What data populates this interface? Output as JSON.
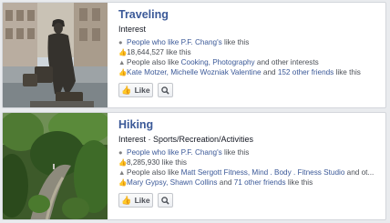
{
  "cards": [
    {
      "title": "Traveling",
      "subtitle": "Interest",
      "lines": [
        {
          "icon": "people-icon",
          "link": "People who like P.F. Chang's",
          "text": " like this"
        },
        {
          "icon": "thumb-up-icon",
          "text": "18,644,527 like this"
        },
        {
          "icon": "network-icon",
          "text": "People also like ",
          "link": "Cooking, Photography",
          "text2": " and other interests"
        },
        {
          "icon": "thumb-up-icon",
          "link": "Kate Motzer, Michelle Wozniak Valentine",
          "text": " and ",
          "link2": "152 other friends",
          "text2": " like this"
        }
      ],
      "like_label": "Like"
    },
    {
      "title": "Hiking",
      "subtitle": "Interest · Sports/Recreation/Activities",
      "lines": [
        {
          "icon": "people-icon",
          "link": "People who like P.F. Chang's",
          "text": " like this"
        },
        {
          "icon": "thumb-up-icon",
          "text": "8,285,930 like this"
        },
        {
          "icon": "network-icon",
          "text": "People also like ",
          "link": "Matt Sergott Fitness, Mind . Body . Fitness Studio",
          "text2": " and ot..."
        },
        {
          "icon": "thumb-up-icon",
          "link": "Mary Gypsy, Shawn Collins",
          "text": " and ",
          "link2": "71 other friends",
          "text2": " like this"
        }
      ],
      "like_label": "Like"
    }
  ],
  "colors": {
    "link": "#3b5998",
    "title": "#3b5998",
    "card_border": "#d3d6db",
    "background": "#e9ebee"
  }
}
